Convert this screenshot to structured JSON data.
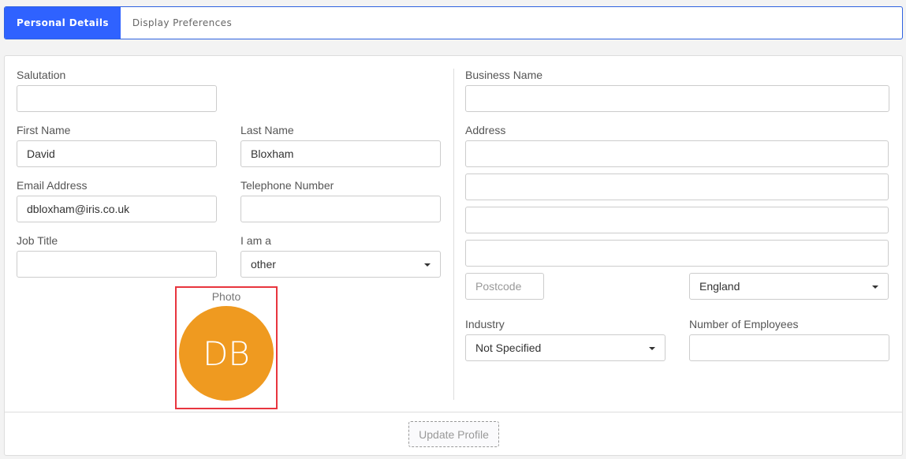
{
  "tabs": [
    {
      "label": "Personal Details",
      "active": true
    },
    {
      "label": "Display Preferences",
      "active": false
    }
  ],
  "personal": {
    "salutation": {
      "label": "Salutation",
      "value": ""
    },
    "first_name": {
      "label": "First Name",
      "value": "David"
    },
    "last_name": {
      "label": "Last Name",
      "value": "Bloxham"
    },
    "email": {
      "label": "Email Address",
      "value": "dbloxham@iris.co.uk"
    },
    "telephone": {
      "label": "Telephone Number",
      "value": ""
    },
    "job_title": {
      "label": "Job Title",
      "value": ""
    },
    "i_am_a": {
      "label": "I am a",
      "value": "other"
    },
    "photo": {
      "label": "Photo",
      "initials": "DB",
      "color": "#ef9a20"
    }
  },
  "business": {
    "business_name": {
      "label": "Business Name",
      "value": ""
    },
    "address": {
      "label": "Address",
      "lines": [
        "",
        "",
        "",
        ""
      ]
    },
    "postcode": {
      "placeholder": "Postcode",
      "value": ""
    },
    "country": {
      "value": "England"
    },
    "industry": {
      "label": "Industry",
      "value": "Not Specified"
    },
    "employees": {
      "label": "Number of Employees",
      "value": ""
    }
  },
  "footer": {
    "update_label": "Update Profile"
  },
  "colors": {
    "accent": "#2f62ff",
    "highlight": "#e8353e"
  }
}
